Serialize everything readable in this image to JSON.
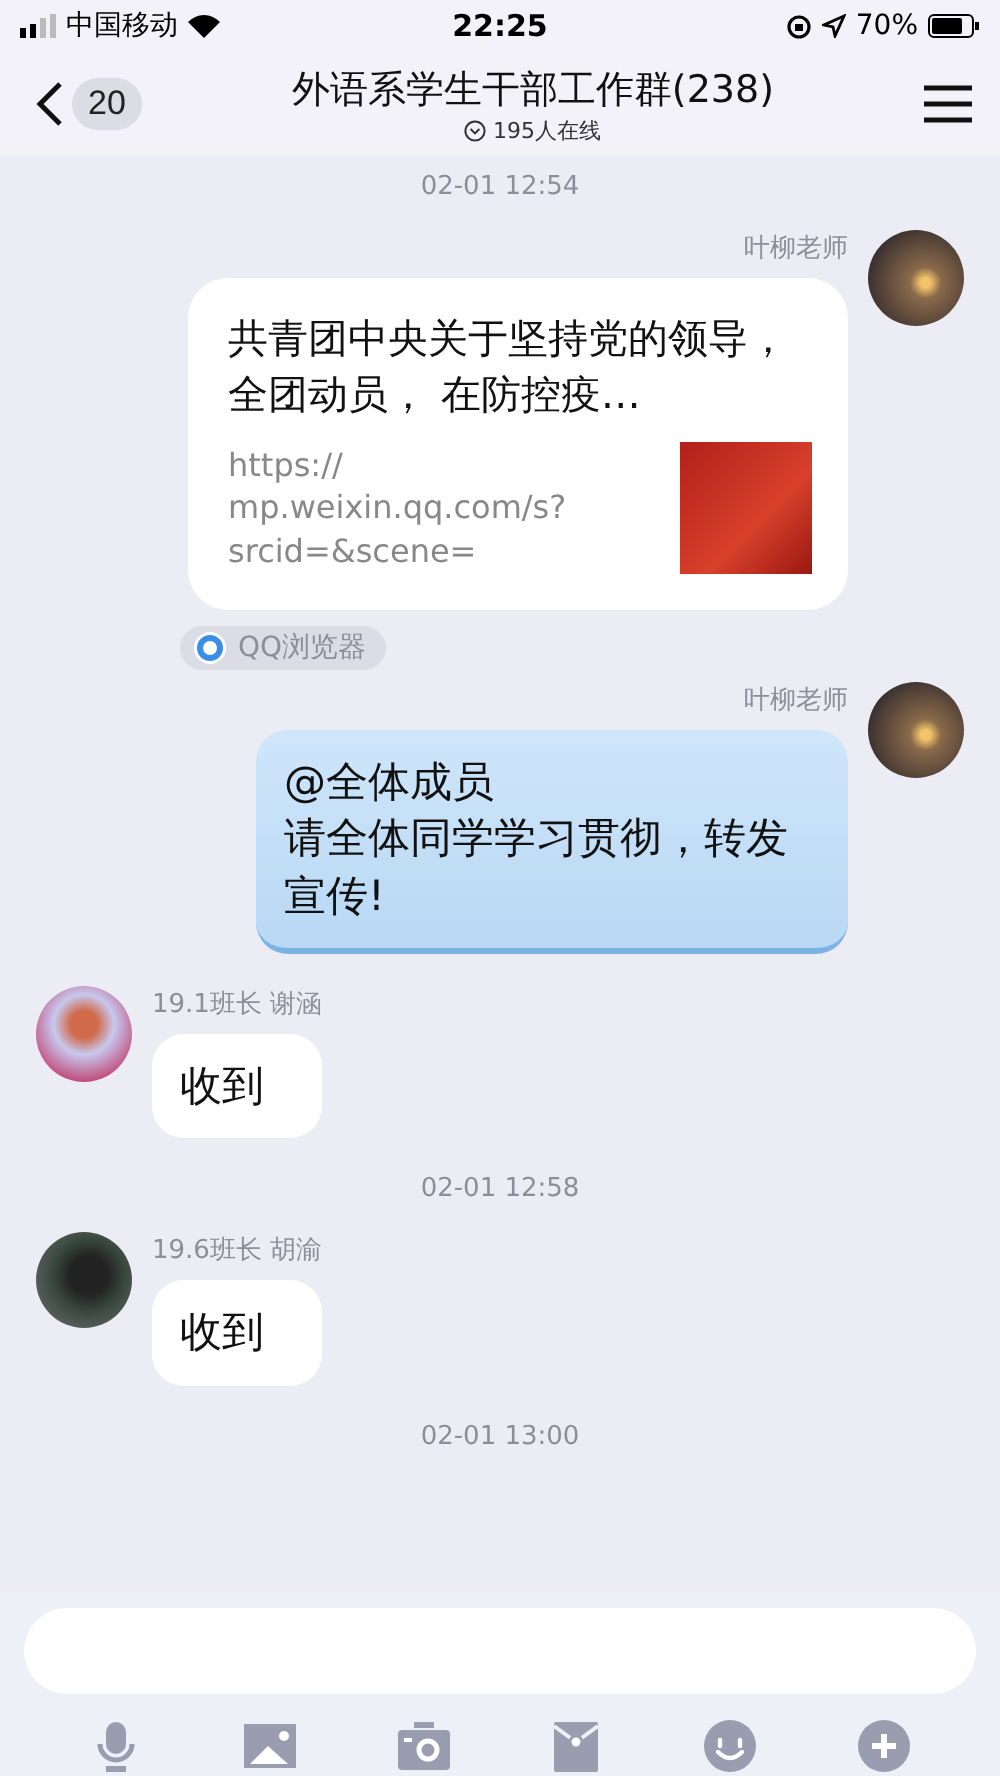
{
  "status_bar": {
    "carrier": "中国移动",
    "time": "22:25",
    "battery": "70%"
  },
  "header": {
    "back_count": "20",
    "title": "外语系学生干部工作群(238)",
    "online": "195人在线"
  },
  "messages": [
    {
      "kind": "time",
      "text": "02-01 12:54"
    },
    {
      "kind": "link",
      "outgoing": true,
      "sender": "叶柳老师",
      "title": "共青团中央关于坚持党的领导，全团动员， 在防控疫…",
      "url": "https://\nmp.weixin.qq.com/s?\nsrcid=&scene=",
      "source": "QQ浏览器"
    },
    {
      "kind": "text",
      "outgoing": true,
      "sender": "叶柳老师",
      "lines": [
        "@全体成员",
        "请全体同学学习贯彻，转发宣传!"
      ]
    },
    {
      "kind": "text",
      "outgoing": false,
      "sender": "19.1班长 谢涵",
      "lines": [
        "收到"
      ]
    },
    {
      "kind": "time",
      "text": "02-01 12:58"
    },
    {
      "kind": "text",
      "outgoing": false,
      "sender": "19.6班长 胡渝",
      "lines": [
        "收到"
      ]
    },
    {
      "kind": "time",
      "text": "02-01 13:00"
    }
  ]
}
